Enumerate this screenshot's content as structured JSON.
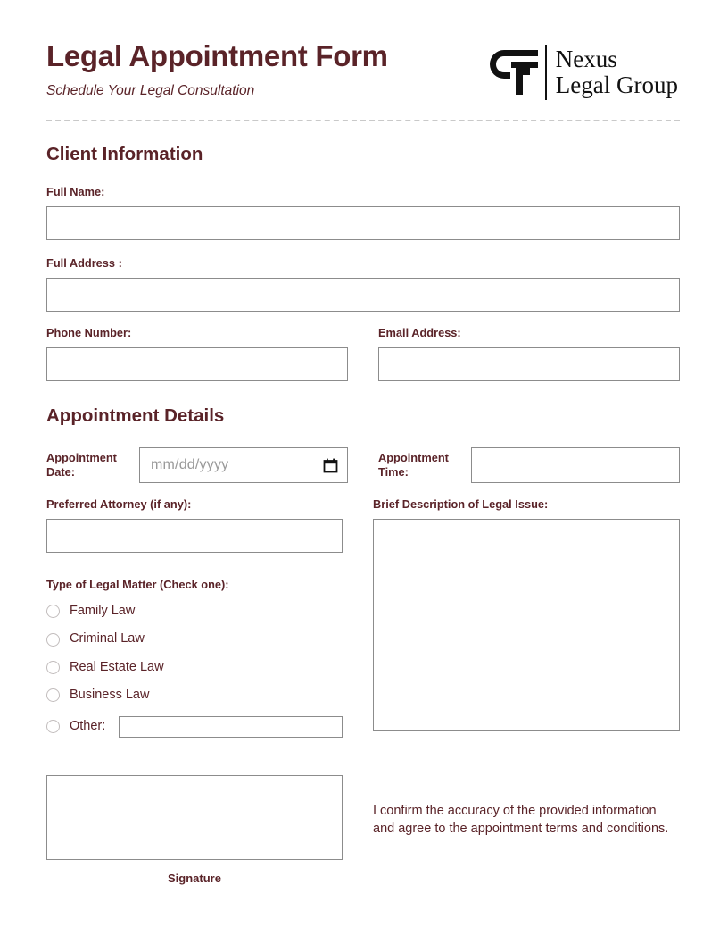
{
  "header": {
    "title": "Legal Appointment Form",
    "subtitle": "Schedule Your Legal Consultation",
    "logo": {
      "mark_icon": "legal-column-mark-icon",
      "line1": "Nexus",
      "line2": "Legal Group"
    }
  },
  "sections": {
    "client": {
      "title": "Client Information",
      "full_name_label": "Full Name:",
      "full_name_value": "",
      "full_address_label": "Full Address :",
      "full_address_value": "",
      "phone_label": "Phone Number:",
      "phone_value": "",
      "email_label": "Email Address:",
      "email_value": ""
    },
    "appointment": {
      "title": "Appointment Details",
      "date_label": "Appointment Date:",
      "date_placeholder": "mm/dd/yyyy",
      "date_value": "",
      "calendar_icon": "calendar-icon",
      "time_label": "Appointment Time:",
      "time_value": "",
      "attorney_label": "Preferred Attorney (if any):",
      "attorney_value": "",
      "description_label": "Brief Description of Legal Issue:",
      "description_value": "",
      "legal_matter_label": "Type of Legal Matter (Check one):",
      "legal_matter_options": [
        {
          "label": "Family Law",
          "selected": false
        },
        {
          "label": "Criminal Law",
          "selected": false
        },
        {
          "label": "Real Estate Law",
          "selected": false
        },
        {
          "label": "Business Law",
          "selected": false
        }
      ],
      "other_label": "Other:",
      "other_value": ""
    },
    "footer": {
      "signature_value": "",
      "signature_caption": "Signature",
      "confirm_text": "I confirm the accuracy of the provided information and agree to the appointment terms and conditions."
    }
  },
  "colors": {
    "accent": "#5a2328",
    "border": "#8c8c8c",
    "divider": "#c9c9c9",
    "logo": "#111111",
    "placeholder": "#9a9a9a"
  }
}
